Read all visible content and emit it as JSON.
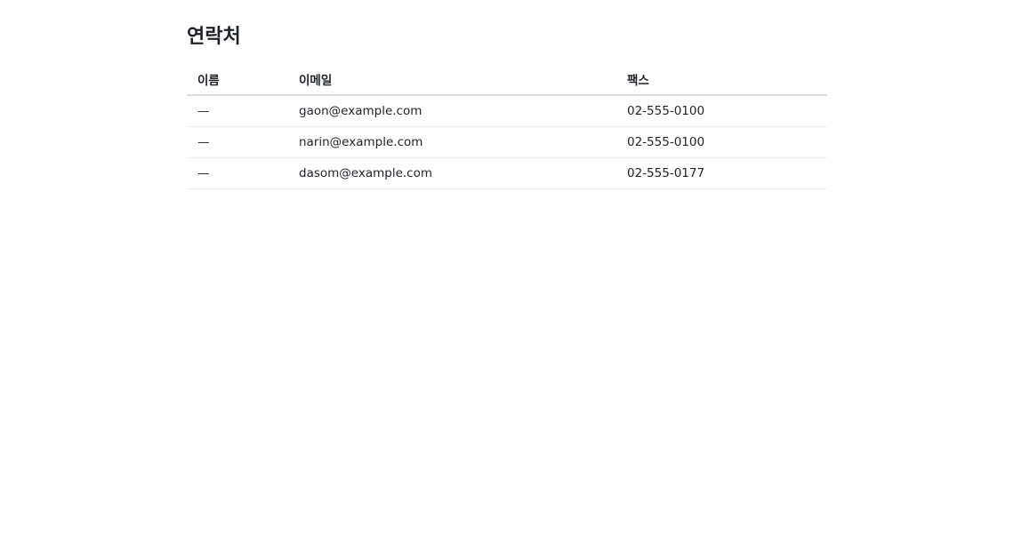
{
  "page": {
    "title": "연락처"
  },
  "table": {
    "headers": {
      "name": "이름",
      "email": "이메일",
      "fax": "팩스"
    },
    "rows": [
      {
        "name": "—",
        "email": "gaon@example.com",
        "fax": "02-555-0100"
      },
      {
        "name": "—",
        "email": "narin@example.com",
        "fax": "02-555-0100"
      },
      {
        "name": "—",
        "email": "dasom@example.com",
        "fax": "02-555-0177"
      }
    ]
  }
}
